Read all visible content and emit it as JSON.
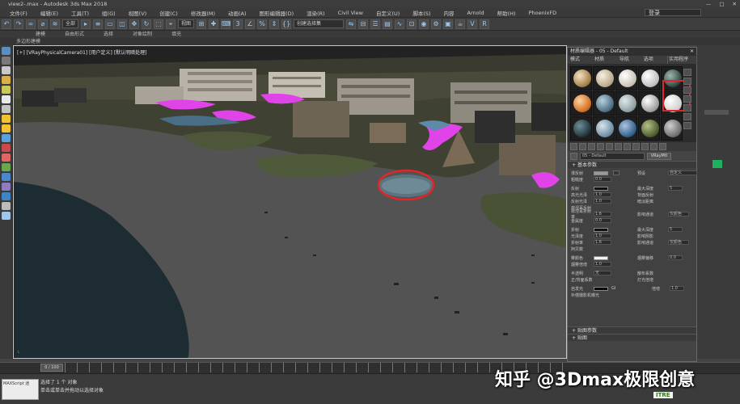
{
  "window": {
    "title": "view2-.max - Autodesk 3ds Max 2018"
  },
  "menubar": {
    "items": [
      "文件(F)",
      "编辑(E)",
      "工具(T)",
      "组(G)",
      "视图(V)",
      "创建(C)",
      "修改器(M)",
      "动画(A)",
      "图形编辑器(D)",
      "渲染(R)",
      "Civil View",
      "自定义(U)",
      "脚本(S)",
      "内容",
      "Arnold",
      "帮助(H)",
      "PhoenixFD"
    ],
    "login": "登录"
  },
  "toolbar": {
    "filter_value": "全部",
    "viewport_value": "视图",
    "selection_set": "创建选择集"
  },
  "ribbon": {
    "tabs": [
      "建模",
      "自由形式",
      "选择",
      "对象绘制",
      "填充"
    ],
    "sub_label": "多边形建模"
  },
  "viewport": {
    "label": "[+] [VRayPhysicalCamera01] [用户定义] [默认明暗处理]",
    "frame_readout": "0 / 100"
  },
  "material_editor": {
    "title": "材质编辑器 - 05 - Default",
    "menu": [
      "模式(D)",
      "材质(M)",
      "导航(N)",
      "选项(O)",
      "实用程序(U)"
    ],
    "material_name": "05 - Default",
    "material_type": "VRayMtl",
    "rollouts": {
      "basic": "基本参数",
      "bump": "贴图参数",
      "maps": "贴图"
    },
    "params": {
      "diffuse": "漫反射",
      "roughness": "粗糙度",
      "roughness_value": "0.0",
      "preset": "预设",
      "preset_value": "自定义",
      "reflect": "反射",
      "hilight_gloss": "高光光泽",
      "hilight_gloss_value": "1.0",
      "refl_gloss": "反射光泽",
      "refl_gloss_value": "1.0",
      "fresnel": "菲涅耳反射",
      "fresnel_ior": "菲涅耳折射率",
      "fresnel_ior_value": "1.6",
      "metalness": "金属度",
      "metalness_value": "0.0",
      "max_depth": "最大深度",
      "max_depth_value": "5",
      "back_side": "背面反射",
      "dim_distance": "暗淡距离",
      "affect_channels": "影响通道",
      "affect_channels_value": "仅颜色",
      "refract": "折射",
      "refr_gloss": "光泽度",
      "refr_gloss_value": "1.0",
      "ior": "折射率",
      "ior_value": "1.6",
      "abbe": "阿贝数",
      "affect_shadows": "影响阴影",
      "fog_color": "雾颜色",
      "fog_multiplier": "烟雾倍增",
      "fog_multiplier_value": "1.0",
      "fog_bias": "烟雾偏移",
      "fog_bias_value": "0.0",
      "translucency": "半透明",
      "translucency_value": "无",
      "scatter_coeff": "散布系数",
      "fwd_bwd": "正/背面系数",
      "light_multiplier": "灯光倍增",
      "self_illum": "自发光",
      "gi": "GI",
      "multiplier": "倍增",
      "multiplier_value": "1.0",
      "compensate": "补偿摄影机曝光"
    }
  },
  "statusbar": {
    "selection": "选择了 1 个 对象",
    "hint": "单击或单击并拖动以选择对象",
    "maxscript": "MAXScript 迷"
  },
  "watermark": {
    "text": "知乎 @3Dmax极限创意",
    "sub": "ITRE"
  },
  "colors": {
    "accent_red": "#e0262a",
    "viewport_ground": "#535353",
    "water": "#1d2b33",
    "lilac_pool": "#e044e8"
  }
}
